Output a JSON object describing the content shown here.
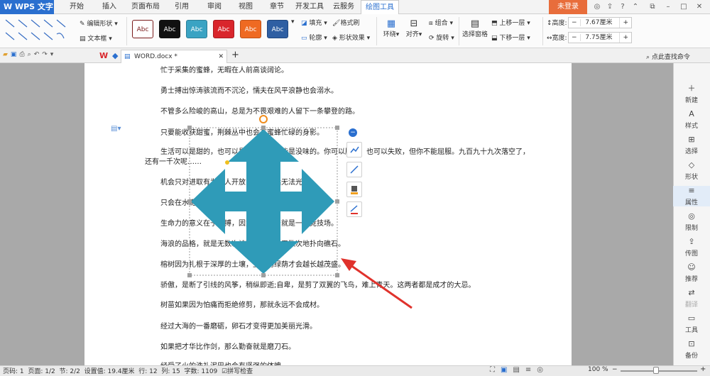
{
  "app": {
    "name": "WPS 文字",
    "login": "未登录"
  },
  "tabs": [
    "开始",
    "插入",
    "页面布局",
    "引用",
    "审阅",
    "视图",
    "章节",
    "开发工具",
    "云服务",
    "绘图工具"
  ],
  "ribbon": {
    "edit_shape": "编辑形状",
    "textbox": "文本框",
    "styles": [
      {
        "label": "Abc",
        "bg": "#ffffff",
        "fg": "#7a1b1b",
        "border": "#7a1b1b"
      },
      {
        "label": "Abc",
        "bg": "#111111",
        "fg": "#ffffff",
        "border": "#111"
      },
      {
        "label": "Abc",
        "bg": "#3aa3c3",
        "fg": "#ffffff",
        "border": "#2c7f98"
      },
      {
        "label": "Abc",
        "bg": "#d9262c",
        "fg": "#ffffff",
        "border": "#a81c21"
      },
      {
        "label": "Abc",
        "bg": "#ef6a22",
        "fg": "#ffffff",
        "border": "#c05216"
      },
      {
        "label": "Abc",
        "bg": "#2f5fa3",
        "fg": "#ffffff",
        "border": "#1f477f"
      }
    ],
    "fill": "填充",
    "format_brush": "格式刷",
    "outline": "轮廓",
    "shape_effect": "形状效果",
    "wrap": "环绕",
    "align": "对齐",
    "combine": "组合",
    "rotate": "旋转",
    "select_pane": "选择窗格",
    "up_layer": "上移一层",
    "down_layer": "下移一层",
    "height_label": "高度:",
    "height_value": "7.67厘米",
    "width_label": "宽度:",
    "width_value": "7.75厘米"
  },
  "doc": {
    "tab": "WORD.docx *",
    "search": "点此查找命令"
  },
  "paragraphs": [
    "忙于采集的蜜蜂，无暇在人前高谈阔论。",
    "勇士搏出惊涛骇流而不沉沦，懦夫在风平浪静也会溺水。",
    "不管多么险峻的高山，总是为不畏艰难的人留下一条攀登的路。",
    "只要能收获甜蜜，荆棘丛中也会有蜜蜂忙碌的身影。",
    "生活可以是甜的，也可以是苦的，但不能是没味的。你可以胜利，也可以失败，但你不能屈服。九百九十九次落空了，",
    "还有一千次呢……",
    "机会只对进取有为的人开放，庸人永远无法光顾。",
    "只会在水泥地上走路的人，永远不会留下深深的脚印。",
    "生命力的意义在于拼搏，因为世界本身就是一个竞技场。",
    "海浪的品格，就是无数次被礁石击碎又无数次地扑向礁石。",
    "榕树因为扎根于深厚的土壤，生命的绿荫才会越长越茂盛。",
    "骄傲，是断了引线的风筝，稍纵即逝;自卑，是剪了双翼的飞鸟，难上青天。这两者都是成才的大忌。",
    "树苗如果因为怕痛而拒绝修剪，那就永远不会成材。",
    "经过大海的一番磨砺，卵石才变得更加美丽光滑。",
    "如果把才华比作剑，那么勤奋就是磨刀石。",
    "经受了火的洗礼泥巴也会有坚强的体魄。"
  ],
  "right_panel": [
    "新建",
    "样式",
    "选择",
    "形状",
    "属性",
    "限制",
    "传图",
    "推荐",
    "翻译",
    "工具",
    "备份"
  ],
  "status": {
    "page_no": "页码: 1",
    "pages": "页面: 1/2",
    "section": "节: 2/2",
    "setting": "设置值: 19.4厘米",
    "row": "行: 12",
    "col": "列: 15",
    "chars": "字数: 1109",
    "spell": "拼写检查",
    "zoom": "100 %"
  },
  "colors": {
    "shape": "#2f9bb8",
    "accent": "#2a6fcf",
    "arrow": "#e0322c"
  }
}
